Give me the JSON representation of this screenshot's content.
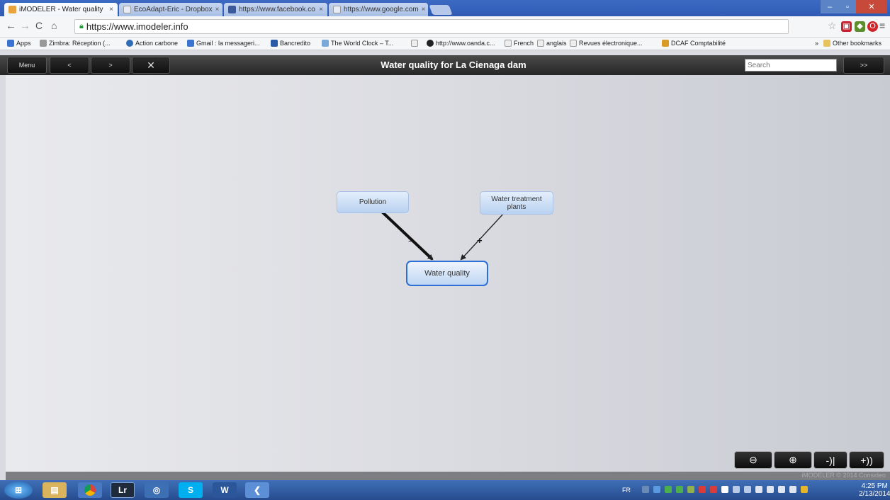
{
  "browser": {
    "tabs": [
      {
        "label": "iMODELER - Water quality",
        "active": true
      },
      {
        "label": "EcoAdapt-Eric - Dropbox",
        "active": false
      },
      {
        "label": "https://www.facebook.co",
        "active": false
      },
      {
        "label": "https://www.google.com",
        "active": false
      }
    ],
    "url": "https://www.imodeler.info",
    "bookmarks": [
      "Apps",
      "Zimbra: Réception (...",
      "Action carbone",
      "Gmail : la messageri...",
      "Bancredito",
      "The World Clock – T...",
      "",
      "http://www.oanda.c...",
      "French",
      "anglais",
      "Revues électronique...",
      "DCAF Comptabilité"
    ],
    "other_bookmarks": "Other bookmarks",
    "bookmarks_more": "»"
  },
  "toolbar": {
    "menu_label": "Menu",
    "back_label": "<",
    "forward_label": ">",
    "fullscreen_label": "✕",
    "title": "Water quality for La Cienaga dam",
    "search_placeholder": "Search",
    "go_label": ">>"
  },
  "model": {
    "nodes": [
      {
        "id": "pollution",
        "label": "Pollution"
      },
      {
        "id": "treatment",
        "label": "Water treatment plants"
      },
      {
        "id": "water_quality",
        "label": "Water quality"
      }
    ],
    "edges": [
      {
        "from": "pollution",
        "to": "water_quality",
        "sign": "="
      },
      {
        "from": "treatment",
        "to": "water_quality",
        "sign": "+"
      }
    ]
  },
  "zoom_controls": [
    "⊖",
    "⊕",
    "-)|",
    "+))"
  ],
  "footer": {
    "copyright": "iMODELER © 2014 Consideo"
  },
  "taskbar": {
    "apps": [
      "start",
      "explorer",
      "chrome",
      "lightroom",
      "app",
      "skype",
      "word",
      "app2"
    ],
    "lang": "FR",
    "time": "4:25 PM",
    "date": "2/13/2014"
  },
  "colors": {
    "accent": "#2c6fd6",
    "node_fill": "#c7dcf5",
    "toolbar_bg": "#262626"
  }
}
